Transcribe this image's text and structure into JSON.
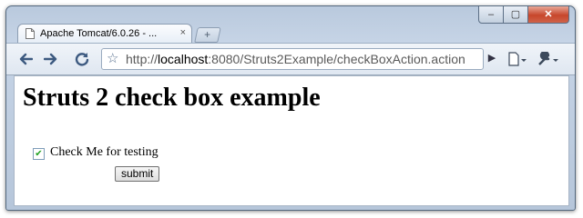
{
  "window": {
    "tab_title": "Apache Tomcat/6.0.26 - ...",
    "tab_close": "×",
    "new_tab": "+",
    "controls": {
      "minimize": "–",
      "maximize": "▢",
      "close": "✕"
    }
  },
  "toolbar": {
    "back_icon": "back-arrow-icon",
    "forward_icon": "forward-arrow-icon",
    "reload_icon": "reload-icon",
    "url_scheme": "http://",
    "url_host": "localhost",
    "url_path": ":8080/Struts2Example/checkBoxAction.action",
    "go_glyph": "▶",
    "page_menu": "🗋▾",
    "tools_menu": "🔧▾"
  },
  "page": {
    "heading": "Struts 2 check box example",
    "checkbox_label": "Check Me for testing",
    "checkbox_checked": true,
    "submit_label": "submit"
  }
}
